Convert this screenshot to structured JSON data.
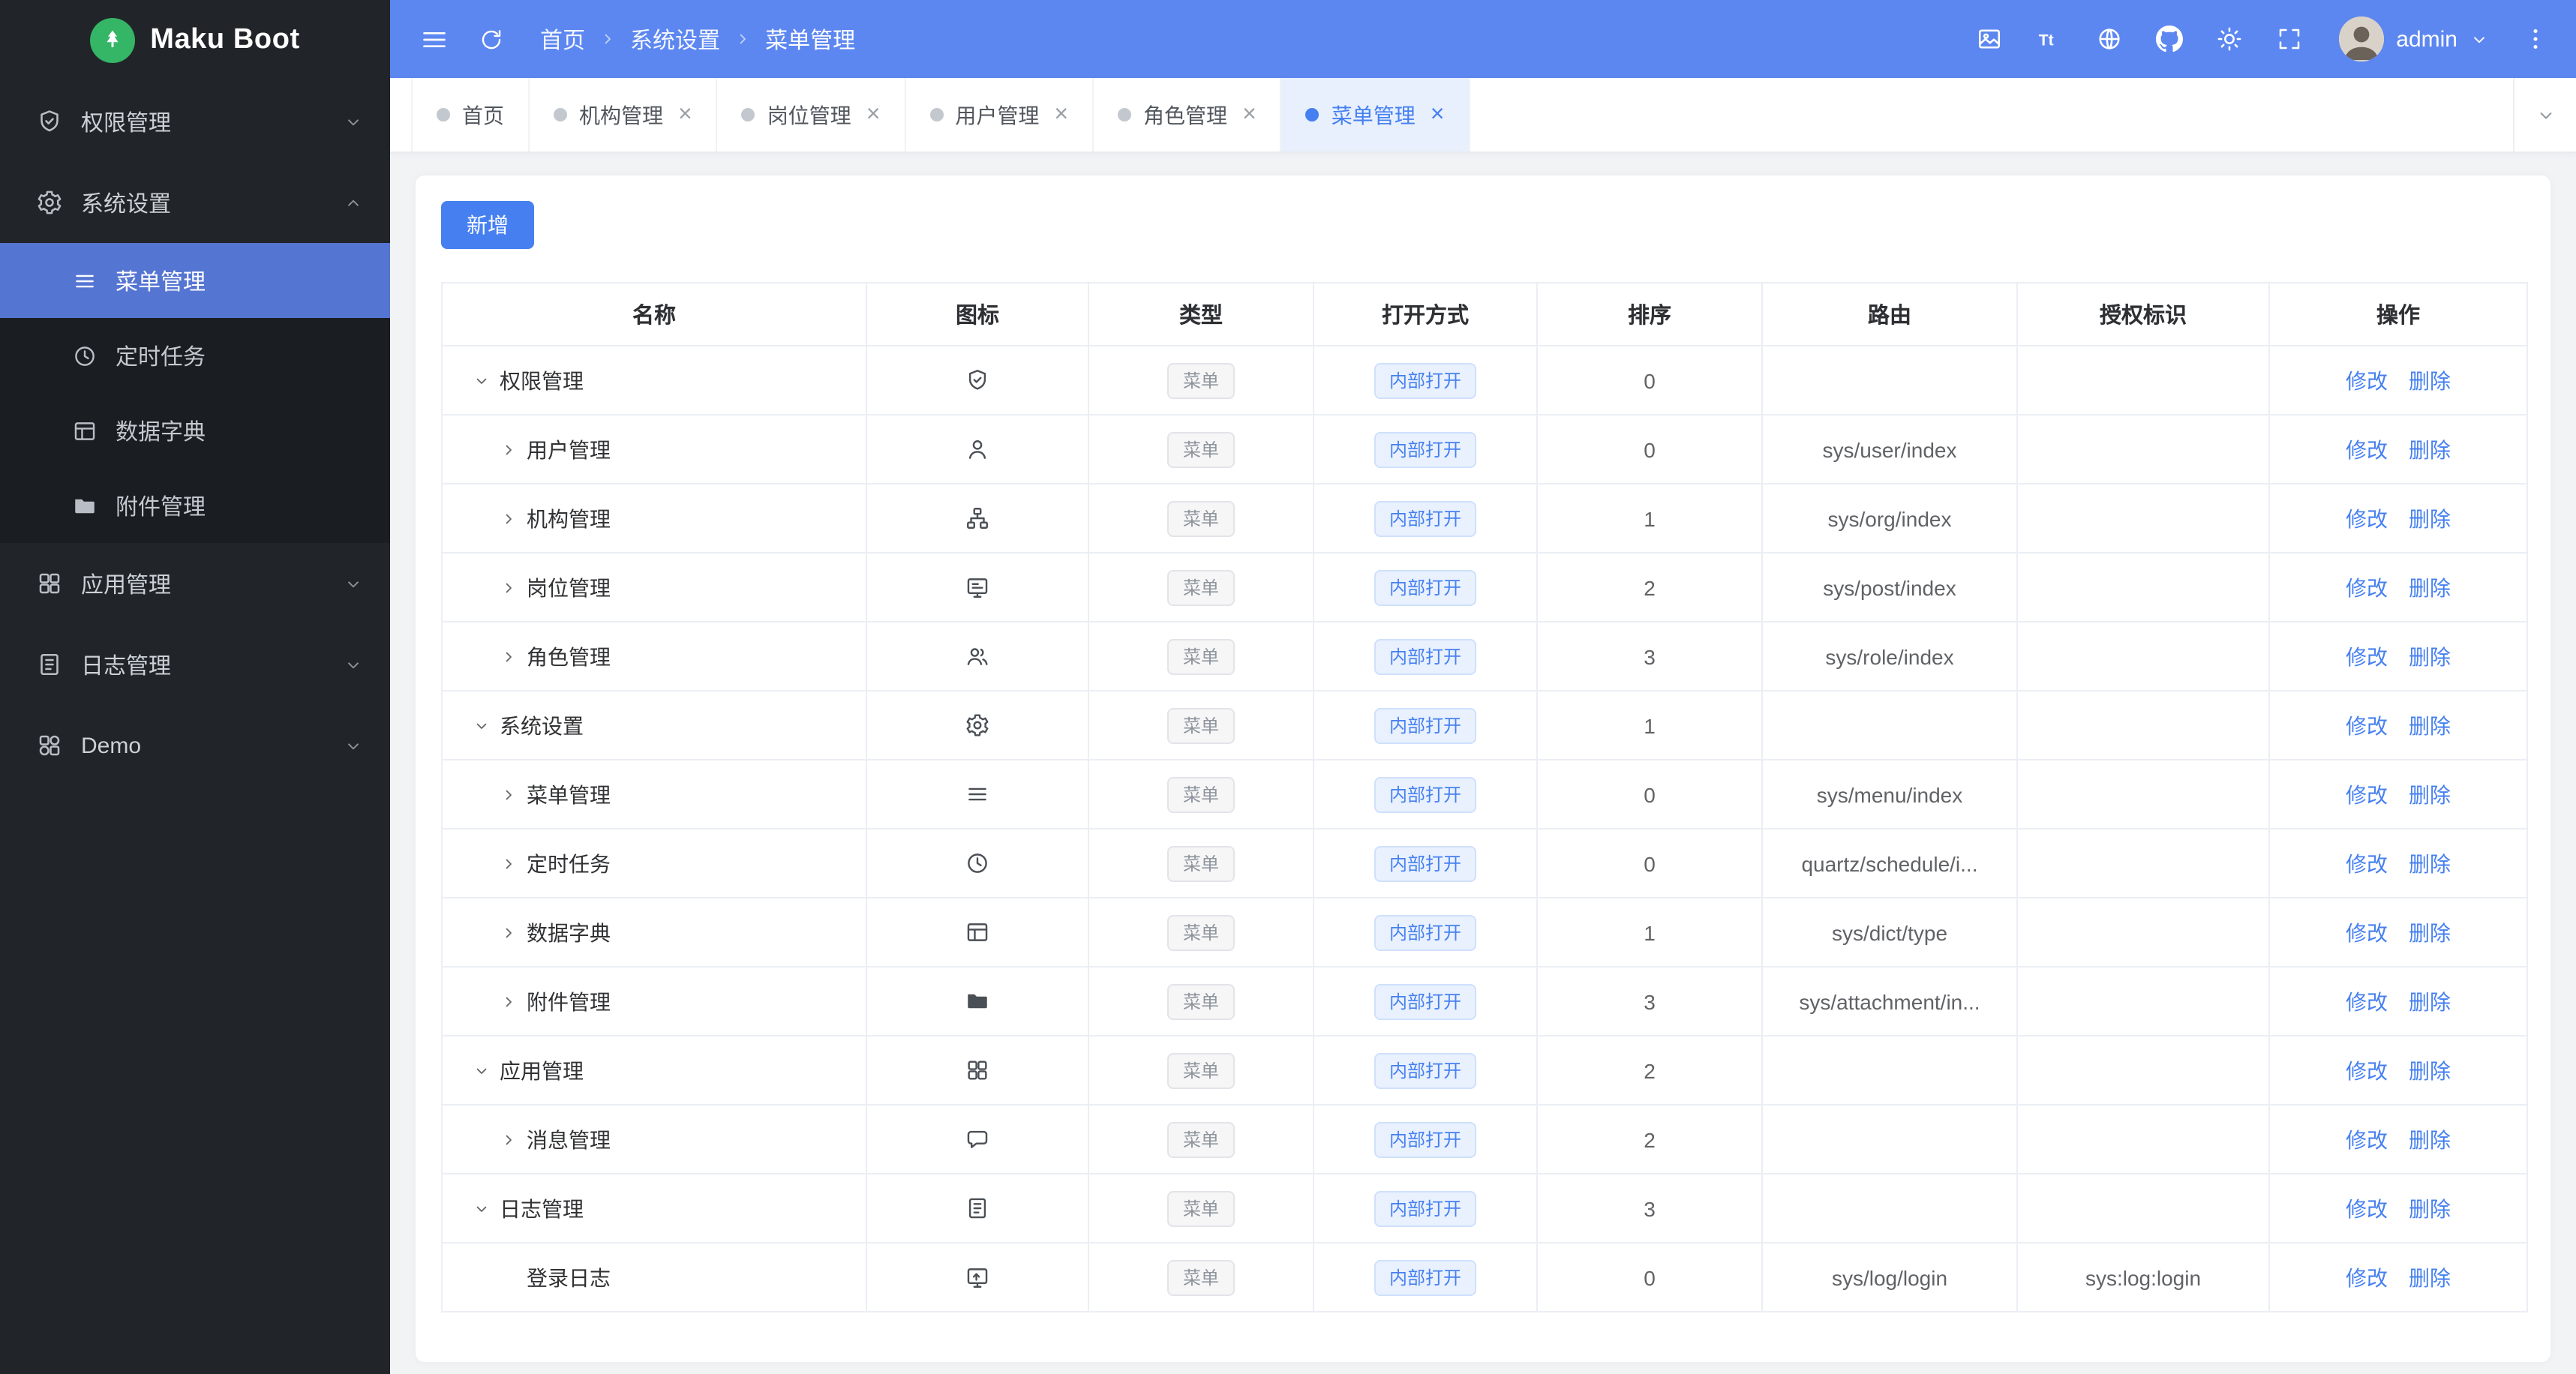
{
  "app": {
    "title": "Maku Boot",
    "user": "admin"
  },
  "colors": {
    "header_blue": "#5d87f0",
    "sidebar_dark": "#212529",
    "sidebar_submenu": "#1a1d21",
    "active_menu_blue": "#5575d2",
    "accent_blue": "#4680f0",
    "logo_green": "#35b566",
    "content_bg": "#f2f3f5",
    "table_border": "#ebeef5"
  },
  "header": {
    "breadcrumb": [
      "首页",
      "系统设置",
      "菜单管理"
    ],
    "actions": [
      {
        "id": "watermark",
        "icon": "watermark-icon"
      },
      {
        "id": "font-size",
        "icon": "font-size-icon"
      },
      {
        "id": "language",
        "icon": "language-icon"
      },
      {
        "id": "github",
        "icon": "github-icon"
      },
      {
        "id": "theme",
        "icon": "theme-icon"
      },
      {
        "id": "fullscreen",
        "icon": "fullscreen-icon"
      }
    ]
  },
  "tabs": [
    {
      "id": "home",
      "label": "首页",
      "closable": false,
      "active": false
    },
    {
      "id": "org",
      "label": "机构管理",
      "closable": true,
      "active": false
    },
    {
      "id": "post",
      "label": "岗位管理",
      "closable": true,
      "active": false
    },
    {
      "id": "user",
      "label": "用户管理",
      "closable": true,
      "active": false
    },
    {
      "id": "role",
      "label": "角色管理",
      "closable": true,
      "active": false
    },
    {
      "id": "menu",
      "label": "菜单管理",
      "closable": true,
      "active": true
    }
  ],
  "sidebar": {
    "items": [
      {
        "id": "permission",
        "label": "权限管理",
        "icon": "shield-icon",
        "state": "collapsed"
      },
      {
        "id": "system",
        "label": "系统设置",
        "icon": "gear-icon",
        "state": "expanded",
        "children": [
          {
            "id": "menu",
            "label": "菜单管理",
            "icon": "menu-icon",
            "active": true
          },
          {
            "id": "schedule",
            "label": "定时任务",
            "icon": "clock-icon",
            "active": false
          },
          {
            "id": "dict",
            "label": "数据字典",
            "icon": "dict-icon",
            "active": false
          },
          {
            "id": "attachment",
            "label": "附件管理",
            "icon": "folder-icon",
            "active": false
          }
        ]
      },
      {
        "id": "apps",
        "label": "应用管理",
        "icon": "apps-icon",
        "state": "collapsed"
      },
      {
        "id": "log",
        "label": "日志管理",
        "icon": "log-icon",
        "state": "collapsed"
      },
      {
        "id": "demo",
        "label": "Demo",
        "icon": "demo-icon",
        "state": "collapsed"
      }
    ]
  },
  "toolbar": {
    "add_label": "新增"
  },
  "table": {
    "columns": [
      {
        "id": "name",
        "label": "名称"
      },
      {
        "id": "icon",
        "label": "图标"
      },
      {
        "id": "type",
        "label": "类型"
      },
      {
        "id": "open",
        "label": "打开方式"
      },
      {
        "id": "sort",
        "label": "排序"
      },
      {
        "id": "route",
        "label": "路由"
      },
      {
        "id": "auth",
        "label": "授权标识"
      },
      {
        "id": "ops",
        "label": "操作"
      }
    ],
    "ops": {
      "edit": "修改",
      "delete": "删除"
    },
    "rows": [
      {
        "name": "权限管理",
        "icon": "shield-icon",
        "type": "菜单",
        "open": "内部打开",
        "sort": "0",
        "route": "",
        "auth": "",
        "level": 0,
        "expand": "expanded"
      },
      {
        "name": "用户管理",
        "icon": "user-icon",
        "type": "菜单",
        "open": "内部打开",
        "sort": "0",
        "route": "sys/user/index",
        "auth": "",
        "level": 1,
        "expand": "collapsed"
      },
      {
        "name": "机构管理",
        "icon": "org-icon",
        "type": "菜单",
        "open": "内部打开",
        "sort": "1",
        "route": "sys/org/index",
        "auth": "",
        "level": 1,
        "expand": "collapsed"
      },
      {
        "name": "岗位管理",
        "icon": "post-icon",
        "type": "菜单",
        "open": "内部打开",
        "sort": "2",
        "route": "sys/post/index",
        "auth": "",
        "level": 1,
        "expand": "collapsed"
      },
      {
        "name": "角色管理",
        "icon": "role-icon",
        "type": "菜单",
        "open": "内部打开",
        "sort": "3",
        "route": "sys/role/index",
        "auth": "",
        "level": 1,
        "expand": "collapsed"
      },
      {
        "name": "系统设置",
        "icon": "gear-icon",
        "type": "菜单",
        "open": "内部打开",
        "sort": "1",
        "route": "",
        "auth": "",
        "level": 0,
        "expand": "expanded"
      },
      {
        "name": "菜单管理",
        "icon": "menu-icon",
        "type": "菜单",
        "open": "内部打开",
        "sort": "0",
        "route": "sys/menu/index",
        "auth": "",
        "level": 1,
        "expand": "collapsed"
      },
      {
        "name": "定时任务",
        "icon": "clock-icon",
        "type": "菜单",
        "open": "内部打开",
        "sort": "0",
        "route": "quartz/schedule/i...",
        "auth": "",
        "level": 1,
        "expand": "collapsed"
      },
      {
        "name": "数据字典",
        "icon": "dict-icon",
        "type": "菜单",
        "open": "内部打开",
        "sort": "1",
        "route": "sys/dict/type",
        "auth": "",
        "level": 1,
        "expand": "collapsed"
      },
      {
        "name": "附件管理",
        "icon": "folder-icon",
        "type": "菜单",
        "open": "内部打开",
        "sort": "3",
        "route": "sys/attachment/in...",
        "auth": "",
        "level": 1,
        "expand": "collapsed"
      },
      {
        "name": "应用管理",
        "icon": "apps-icon",
        "type": "菜单",
        "open": "内部打开",
        "sort": "2",
        "route": "",
        "auth": "",
        "level": 0,
        "expand": "expanded"
      },
      {
        "name": "消息管理",
        "icon": "message-icon",
        "type": "菜单",
        "open": "内部打开",
        "sort": "2",
        "route": "",
        "auth": "",
        "level": 1,
        "expand": "collapsed"
      },
      {
        "name": "日志管理",
        "icon": "log-icon",
        "type": "菜单",
        "open": "内部打开",
        "sort": "3",
        "route": "",
        "auth": "",
        "level": 0,
        "expand": "expanded"
      },
      {
        "name": "登录日志",
        "icon": "loginlog-icon",
        "type": "菜单",
        "open": "内部打开",
        "sort": "0",
        "route": "sys/log/login",
        "auth": "sys:log:login",
        "level": 1,
        "expand": "none"
      }
    ]
  }
}
